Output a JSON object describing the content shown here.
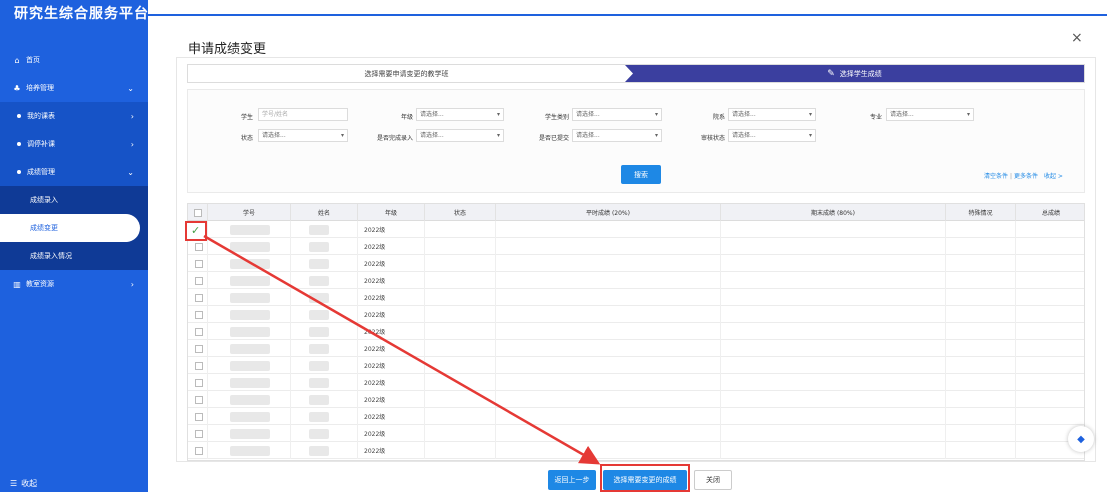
{
  "sidebar": {
    "title": "研究生综合服务平台",
    "home": "首页",
    "training": "培养管理",
    "my_courses": "我的课表",
    "retake": "调停补课",
    "grades": "成绩管理",
    "grade_entry": "成绩录入",
    "grade_change": "成绩变更",
    "grade_entry_status": "成绩录入情况",
    "classroom": "教室资源",
    "collapse": "收起"
  },
  "dialog": {
    "title": "申请成绩变更",
    "close": "×"
  },
  "steps": {
    "step1": "选择需要申请变更的教学班",
    "step2": "选择学生成绩"
  },
  "filter": {
    "student_label": "学生",
    "student_placeholder": "学号/姓名",
    "grade_label": "年级",
    "student_type_label": "学生类别",
    "dept_label": "院系",
    "major_label": "专业",
    "status_label": "状态",
    "entered_label": "是否完成录入",
    "submitted_label": "是否已提交",
    "review_label": "审核状态",
    "select_placeholder": "请选择...",
    "search": "搜索",
    "clear": "清空条件",
    "more": "更多条件",
    "collapse": "收起 >"
  },
  "table": {
    "headers": [
      "学号",
      "姓名",
      "年级",
      "状态",
      "平时成绩 (20%)",
      "期末成绩 (80%)",
      "特殊情况",
      "总成绩"
    ],
    "rows": [
      "2022级",
      "2022级",
      "2022级",
      "2022级",
      "2022级",
      "2022级",
      "2022级",
      "2022级",
      "2022级",
      "2022级",
      "2022级",
      "2022级",
      "2022级",
      "2022级"
    ]
  },
  "footer": {
    "back": "返回上一步",
    "select": "选择需要变更的成绩",
    "close": "关闭"
  },
  "colors": {
    "sidebar": "#1e61de",
    "step_active": "#3b3f9f",
    "button": "#1e88e5",
    "annotation": "#e53935"
  }
}
